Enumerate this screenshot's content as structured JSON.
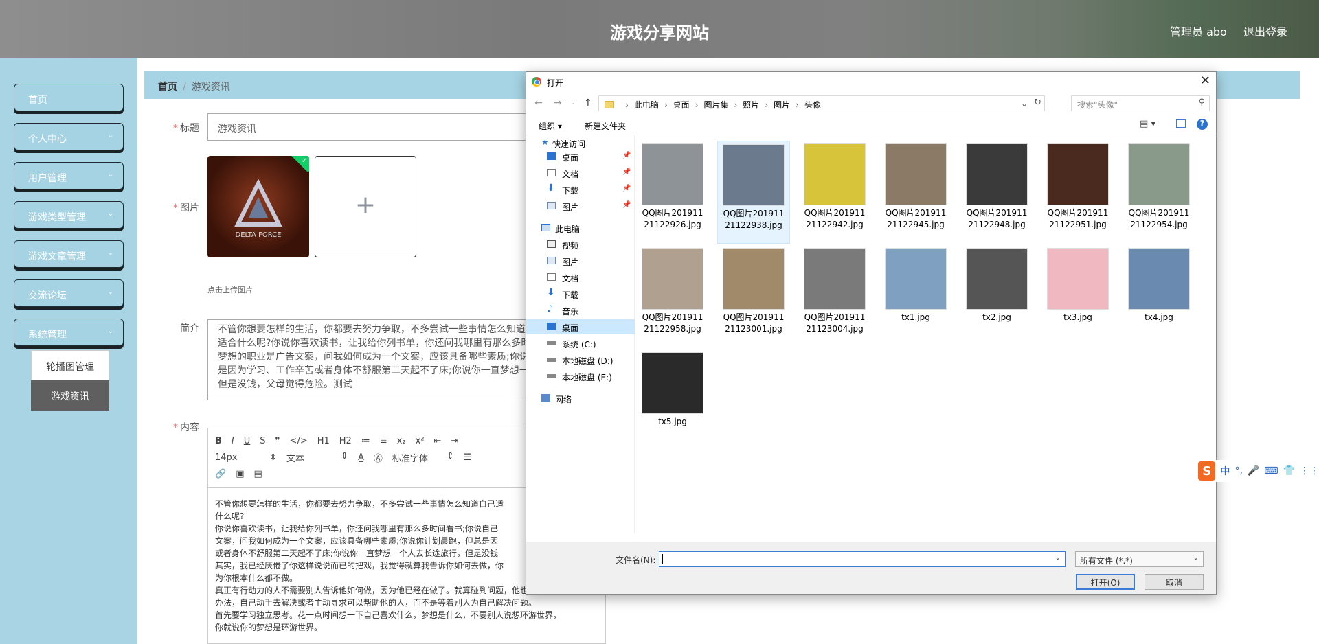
{
  "header": {
    "title": "游戏分享网站",
    "user": "管理员 abo",
    "logout": "退出登录"
  },
  "sidebar": {
    "items": [
      {
        "label": "首页",
        "has_arrow": false
      },
      {
        "label": "个人中心",
        "has_arrow": true
      },
      {
        "label": "用户管理",
        "has_arrow": true
      },
      {
        "label": "游戏类型管理",
        "has_arrow": true
      },
      {
        "label": "游戏文章管理",
        "has_arrow": true
      },
      {
        "label": "交流论坛",
        "has_arrow": true
      },
      {
        "label": "系统管理",
        "has_arrow": true
      }
    ],
    "submenu": [
      {
        "label": "轮播图管理"
      },
      {
        "label": "游戏资讯"
      }
    ]
  },
  "breadcrumb": {
    "home": "首页",
    "separator": "/",
    "current": "游戏资讯"
  },
  "form": {
    "title_label": "标题",
    "title_value": "游戏资讯",
    "image_label": "图片",
    "image_caption": "DELTA FORCE",
    "upload_tip": "点击上传图片",
    "intro_label": "简介",
    "intro_lines": [
      "不管你想要怎样的生活，你都要去努力争取，不多尝试一些事情怎么知道",
      "适合什么呢?你说你喜欢读书，让我给你列书单，你还问我哪里有那么多时",
      "梦想的职业是广告文案，问我如何成为一个文案，应该具备哪些素质;你说",
      "是因为学习、工作辛苦或者身体不舒服第二天起不了床;你说你一直梦想一",
      "但是没钱，父母觉得危险。测试"
    ],
    "content_label": "内容",
    "editor_toolbar": {
      "row1": [
        "B",
        "I",
        "U",
        "S",
        "❞",
        "</>",
        "H1",
        "H2",
        "≔",
        "≡",
        "x₂",
        "x²",
        "⇤",
        "⇥"
      ],
      "size": "14px",
      "format": "文本",
      "font": "标准字体",
      "row3": [
        "🔗",
        "▣",
        "▤"
      ]
    },
    "content_lines": [
      "不管你想要怎样的生活，你都要去努力争取，不多尝试一些事情怎么知道自己适",
      "什么呢?",
      "你说你喜欢读书，让我给你列书单，你还问我哪里有那么多时间看书;你说自己",
      "文案，问我如何成为一个文案，应该具备哪些素质;你说你计划晨跑，但总是因",
      "或者身体不舒服第二天起不了床;你说你一直梦想一个人去长途旅行，但是没钱",
      "其实，我已经厌倦了你这样说说而已的把戏，我觉得就算我告诉你如何去做，你",
      "为你根本什么都不做。",
      "真正有行动力的人不需要别人告诉他如何做，因为他已经在做了。就算碰到问题，他也会自己想",
      "办法，自己动手去解决或者主动寻求可以帮助他的人，而不是等着别人为自己解决问题。",
      "首先要学习独立思考。花一点时间想一下自己喜欢什么，梦想是什么，不要别人说想环游世界，",
      "你就说你的梦想是环游世界。"
    ]
  },
  "dialog": {
    "title": "打开",
    "path": [
      "此电脑",
      "桌面",
      "图片集",
      "照片",
      "图片",
      "头像"
    ],
    "search_placeholder": "搜索\"头像\"",
    "organize": "组织 ▾",
    "new_folder": "新建文件夹",
    "nav": {
      "quick_access": "快速访问",
      "quick_items": [
        "桌面",
        "文档",
        "下载",
        "图片"
      ],
      "this_pc": "此电脑",
      "pc_items": [
        "视频",
        "图片",
        "文档",
        "下载",
        "音乐",
        "桌面",
        "系统 (C:)",
        "本地磁盘 (D:)",
        "本地磁盘 (E:)"
      ],
      "network": "网络"
    },
    "files": [
      {
        "name": "QQ图片20191121122926.jpg",
        "color": "#8d9397"
      },
      {
        "name": "QQ图片20191121122938.jpg",
        "color": "#6b7a8c"
      },
      {
        "name": "QQ图片20191121122942.jpg",
        "color": "#d8c43a"
      },
      {
        "name": "QQ图片20191121122945.jpg",
        "color": "#8a7a66"
      },
      {
        "name": "QQ图片20191121122948.jpg",
        "color": "#3a3a3a"
      },
      {
        "name": "QQ图片20191121122951.jpg",
        "color": "#4a2a1e"
      },
      {
        "name": "QQ图片20191121122954.jpg",
        "color": "#8a9a8a"
      },
      {
        "name": "QQ图片20191121122958.jpg",
        "color": "#b0a090"
      },
      {
        "name": "QQ图片20191121123001.jpg",
        "color": "#a08a6a"
      },
      {
        "name": "QQ图片20191121123004.jpg",
        "color": "#7a7a7a"
      },
      {
        "name": "tx1.jpg",
        "color": "#7fa0c0"
      },
      {
        "name": "tx2.jpg",
        "color": "#555555"
      },
      {
        "name": "tx3.jpg",
        "color": "#f0b8c0"
      },
      {
        "name": "tx4.jpg",
        "color": "#6a8ab0"
      },
      {
        "name": "tx5.jpg",
        "color": "#2a2a2a"
      }
    ],
    "filename_label": "文件名(N):",
    "filetype": "所有文件 (*.*)",
    "open_btn": "打开(O)",
    "cancel_btn": "取消"
  },
  "ime": {
    "logo": "S",
    "items": [
      "中",
      "°,",
      "🎤",
      "⌨",
      "👕",
      "⋮⋮"
    ]
  }
}
